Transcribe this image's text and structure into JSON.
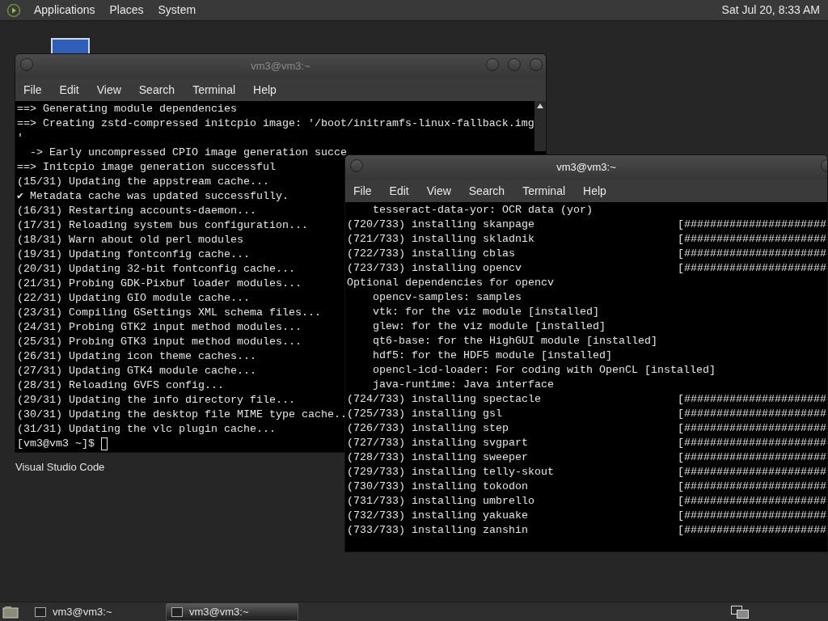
{
  "top_panel": {
    "menus": [
      "Applications",
      "Places",
      "System"
    ],
    "clock": "Sat Jul 20, 8:33 AM"
  },
  "desktop_icons": [
    {
      "label": "Visual Studio Code"
    }
  ],
  "windows": [
    {
      "title": "vm3@vm3:~",
      "active": false,
      "menu": [
        "File",
        "Edit",
        "View",
        "Search",
        "Terminal",
        "Help"
      ],
      "lines": [
        {
          "text": "==> Generating module dependencies"
        },
        {
          "text": "==> Creating zstd-compressed initcpio image: '/boot/initramfs-linux-fallback.img"
        },
        {
          "text": "'"
        },
        {
          "text": "  -> Early uncompressed CPIO image generation succe"
        },
        {
          "text": "==> Initcpio image generation successful"
        },
        {
          "text": "(15/31) Updating the appstream cache..."
        },
        {
          "text": "✔ Metadata cache was updated successfully."
        },
        {
          "text": "(16/31) Restarting accounts-daemon..."
        },
        {
          "text": "(17/31) Reloading system bus configuration..."
        },
        {
          "text": "(18/31) Warn about old perl modules"
        },
        {
          "text": "(19/31) Updating fontconfig cache..."
        },
        {
          "text": "(20/31) Updating 32-bit fontconfig cache..."
        },
        {
          "text": "(21/31) Probing GDK-Pixbuf loader modules..."
        },
        {
          "text": "(22/31) Updating GIO module cache..."
        },
        {
          "text": "(23/31) Compiling GSettings XML schema files..."
        },
        {
          "text": "(24/31) Probing GTK2 input method modules..."
        },
        {
          "text": "(25/31) Probing GTK3 input method modules..."
        },
        {
          "text": "(26/31) Updating icon theme caches..."
        },
        {
          "text": "(27/31) Updating GTK4 module cache..."
        },
        {
          "text": "(28/31) Reloading GVFS config..."
        },
        {
          "text": "(29/31) Updating the info directory file..."
        },
        {
          "text": "(30/31) Updating the desktop file MIME type cache.."
        },
        {
          "text": "(31/31) Updating the vlc plugin cache..."
        }
      ],
      "prompt": "[vm3@vm3 ~]$"
    },
    {
      "title": "vm3@vm3:~",
      "active": true,
      "menu": [
        "File",
        "Edit",
        "View",
        "Search",
        "Terminal",
        "Help"
      ],
      "lines": [
        {
          "text": "    tesseract-data-yor: OCR data (yor)"
        },
        {
          "text": "(720/733) installing skanpage",
          "progress": "[######################"
        },
        {
          "text": "(721/733) installing skladnik",
          "progress": "[######################"
        },
        {
          "text": "(722/733) installing cblas",
          "progress": "[######################"
        },
        {
          "text": "(723/733) installing opencv",
          "progress": "[######################"
        },
        {
          "text": "Optional dependencies for opencv"
        },
        {
          "text": "    opencv-samples: samples"
        },
        {
          "text": "    vtk: for the viz module [installed]"
        },
        {
          "text": "    glew: for the viz module [installed]"
        },
        {
          "text": "    qt6-base: for the HighGUI module [installed]"
        },
        {
          "text": "    hdf5: for the HDF5 module [installed]"
        },
        {
          "text": "    opencl-icd-loader: For coding with OpenCL [installed]"
        },
        {
          "text": "    java-runtime: Java interface"
        },
        {
          "text": "(724/733) installing spectacle",
          "progress": "[######################"
        },
        {
          "text": "(725/733) installing gsl",
          "progress": "[######################"
        },
        {
          "text": "(726/733) installing step",
          "progress": "[######################"
        },
        {
          "text": "(727/733) installing svgpart",
          "progress": "[######################"
        },
        {
          "text": "(728/733) installing sweeper",
          "progress": "[######################"
        },
        {
          "text": "(729/733) installing telly-skout",
          "progress": "[######################"
        },
        {
          "text": "(730/733) installing tokodon",
          "progress": "[######################"
        },
        {
          "text": "(731/733) installing umbrello",
          "progress": "[######################"
        },
        {
          "text": "(732/733) installing yakuake",
          "progress": "[######################"
        },
        {
          "text": "(733/733) installing zanshin",
          "progress": "[######################"
        }
      ]
    }
  ],
  "taskbar": {
    "tasks": [
      {
        "label": "vm3@vm3:~",
        "selected": false
      },
      {
        "label": "vm3@vm3:~",
        "selected": true
      }
    ]
  }
}
